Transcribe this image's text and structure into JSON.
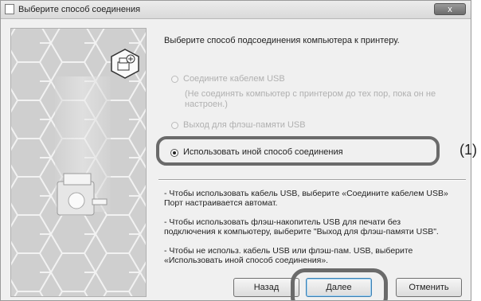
{
  "window": {
    "title": "Выберите способ соединения",
    "close_label": "x"
  },
  "heading": "Выберите способ подсоединения компьютера к принтеру.",
  "options": {
    "usb": {
      "label": "Соедините кабелем USB",
      "note_line1": "(Не соединять компьютер с принтером до тех пор, пока он не",
      "note_line2": "настроен.)"
    },
    "flash": {
      "label": "Выход для флэш-памяти USB"
    },
    "other": {
      "label": "Использовать иной способ соединения",
      "selected": true
    }
  },
  "callout_label": "(1)",
  "notes": [
    [
      "- Чтобы использовать кабель USB, выберите «Соедините кабелем USB»",
      "Порт настраивается автомат."
    ],
    [
      "- Чтобы использовать флэш-накопитель USB для печати без",
      "подключения к компьютеру, выберите \"Выход для флэш-памяти USB\"."
    ],
    [
      "- Чтобы не использ. кабель USB или флэш-пам. USB, выберите",
      "«Использовать иной способ соединения»."
    ]
  ],
  "buttons": {
    "back": "Назад",
    "next": "Далее",
    "cancel": "Отменить"
  },
  "colors": {
    "window_bg": "#f0f0f0",
    "highlight_ring": "#6a6a6a",
    "disabled_text": "#b0b0b0",
    "close_button": "#7a7a7a"
  }
}
